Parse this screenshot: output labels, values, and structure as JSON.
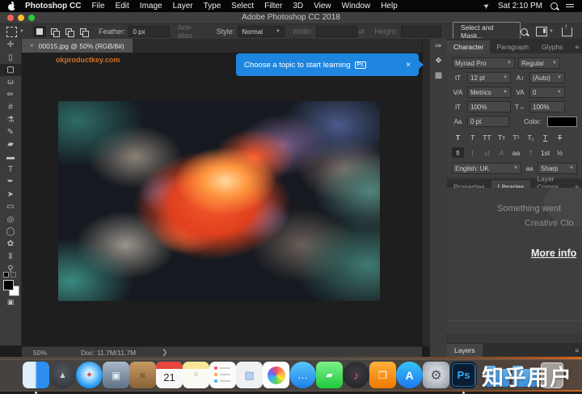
{
  "window": {
    "title": "Adobe Photoshop CC 2018"
  },
  "menu_bar": {
    "app_name": "Photoshop CC",
    "items": [
      "File",
      "Edit",
      "Image",
      "Layer",
      "Type",
      "Select",
      "Filter",
      "3D",
      "View",
      "Window",
      "Help"
    ],
    "clock": "Sat 2:10 PM"
  },
  "options_bar": {
    "feather_label": "Feather:",
    "feather_value": "0 px",
    "anti_alias_label": "Anti-alias",
    "style_label": "Style:",
    "style_value": "Normal",
    "width_label": "Width:",
    "height_label": "Height:",
    "select_and_mask_label": "Select and Mask...",
    "mode_buttons": [
      "new-selection",
      "add-to-selection",
      "subtract-from-selection",
      "intersect-with-selection"
    ]
  },
  "toolbar": {
    "tools": [
      {
        "name": "move-tool",
        "glyph": "✛"
      },
      {
        "name": "artboard-tool",
        "glyph": "▯"
      },
      {
        "name": "rectangular-marquee-tool",
        "glyph": "▢",
        "active": true
      },
      {
        "name": "lasso-tool",
        "glyph": "ω"
      },
      {
        "name": "quick-selection-tool",
        "glyph": "✏"
      },
      {
        "name": "crop-tool",
        "glyph": "#"
      },
      {
        "name": "eyedropper-tool",
        "glyph": "⚗"
      },
      {
        "name": "brush-tool",
        "glyph": "✎"
      },
      {
        "name": "eraser-tool",
        "glyph": "▰"
      },
      {
        "name": "gradient-tool",
        "glyph": "▬"
      },
      {
        "name": "type-tool",
        "glyph": "T"
      },
      {
        "name": "pen-tool",
        "glyph": "✒"
      },
      {
        "name": "path-selection-tool",
        "glyph": "➤"
      },
      {
        "name": "rectangle-tool",
        "glyph": "▭"
      },
      {
        "name": "ellipse-ring-tool",
        "glyph": "◎"
      },
      {
        "name": "ellipse-tool",
        "glyph": "◯"
      },
      {
        "name": "custom-shape-tool",
        "glyph": "✿"
      },
      {
        "name": "hand-tool",
        "glyph": "ʬ"
      },
      {
        "name": "zoom-tool",
        "glyph": "⚲"
      },
      {
        "name": "edit-toolbar",
        "glyph": "…"
      }
    ]
  },
  "document": {
    "tab_title": "00015.jpg @ 50% (RGB/8#)",
    "close": "×",
    "watermark": "okproductkey.com"
  },
  "notification": {
    "message": "Choose a topic to start learning",
    "badge": "Ps",
    "close": "×",
    "accent_color": "#1f86e0"
  },
  "right_panel": {
    "collapsed_icons": [
      {
        "name": "clone-source-panel-icon",
        "glyph": "✑"
      },
      {
        "name": "swatches-panel-icon",
        "glyph": "❖"
      },
      {
        "name": "character-styles-panel-icon",
        "glyph": "▦"
      }
    ],
    "character": {
      "tabs": [
        "Character",
        "Paragraph",
        "Glyphs"
      ],
      "font_family": "Myriad Pro",
      "font_style": "Regular",
      "size_icon": "tT",
      "size": "12 pt",
      "leading_icon": "A↕",
      "leading": "(Auto)",
      "kerning_icon": "V∕A",
      "kerning": "Metrics",
      "tracking_icon": "VA",
      "tracking": "0",
      "vscale_icon": "IT",
      "vscale": "100%",
      "hscale_icon": "T↔",
      "hscale": "100%",
      "baseline_icon": "Aa",
      "baseline": "0 pt",
      "color_label": "Color:",
      "color_value": "#000000",
      "style_buttons": [
        {
          "name": "faux-bold-button",
          "glyph": "T",
          "cls": "b"
        },
        {
          "name": "faux-italic-button",
          "glyph": "T",
          "cls": "i"
        },
        {
          "name": "all-caps-button",
          "glyph": "TT"
        },
        {
          "name": "small-caps-button",
          "glyph": "Tᴛ"
        },
        {
          "name": "superscript-button",
          "glyph": "T¹"
        },
        {
          "name": "subscript-button",
          "glyph": "T₁"
        },
        {
          "name": "underline-button",
          "glyph": "T",
          "cls": "u"
        },
        {
          "name": "strikethrough-button",
          "glyph": "T",
          "cls": "s"
        }
      ],
      "opentype_buttons": [
        {
          "name": "standard-ligatures-button",
          "glyph": "fi",
          "active": true
        },
        {
          "name": "contextual-alternates-button",
          "glyph": "ſ",
          "dis": true
        },
        {
          "name": "discretionary-ligatures-button",
          "glyph": "st",
          "dis": true
        },
        {
          "name": "swash-button",
          "glyph": "A",
          "cls": "i",
          "dis": true
        },
        {
          "name": "stylistic-alternates-button",
          "glyph": "aa"
        },
        {
          "name": "titling-alternates-button",
          "glyph": "T",
          "dis": true
        },
        {
          "name": "ordinals-button",
          "glyph": "1st"
        },
        {
          "name": "fractions-button",
          "glyph": "½"
        }
      ],
      "language": "English: UK",
      "antialias_icon": "aa",
      "antialias": "Sharp"
    },
    "panel_tabs": [
      "Properties",
      "Libraries",
      "Layer Comps"
    ],
    "libraries": {
      "line1": "Something went",
      "line2": "Creative Clo",
      "link": "More info"
    },
    "layers_tab": "Layers"
  },
  "status_bar": {
    "zoom": "50%",
    "doc_size": "Doc: 11.7M/11.7M",
    "chevron": "❯"
  },
  "dock": {
    "apps": [
      {
        "name": "finder",
        "shape": "sq",
        "bg": "linear-gradient(90deg,#dff0fb 0 47%,#2e8ef0 53%)",
        "glyph": "",
        "running": true
      },
      {
        "name": "launchpad",
        "shape": "ci",
        "bg": "radial-gradient(circle at 50% 40%,#53575f,#2b2e34)",
        "glyph": "▲",
        "gc": "#c9ced6",
        "gs": 11
      },
      {
        "name": "safari",
        "shape": "ci",
        "bg": "radial-gradient(circle at 50% 45%,#cdeeff 0 16%,#2a9df4 62%,#1470d8)",
        "glyph": "✦",
        "gc": "#e8453c",
        "gs": 11
      },
      {
        "name": "mail",
        "shape": "sq",
        "bg": "linear-gradient(180deg,#a8b8c8,#5e7186)",
        "glyph": "▣",
        "gc": "#e5edf4",
        "gs": 12
      },
      {
        "name": "contacts",
        "shape": "sq",
        "bg": "linear-gradient(180deg,#c89a62,#8a6336)",
        "glyph": "≡",
        "gc": "#5d4326",
        "gs": 12
      },
      {
        "name": "calendar",
        "shape": "sq",
        "bg": "#f8f8f8",
        "glyph": "21",
        "gc": "#2b2b2b",
        "gs": 13,
        "special": "calendar"
      },
      {
        "name": "notes",
        "shape": "sq",
        "bg": "linear-gradient(180deg,#f6e896 0 27%,#fbfbf6 27%)",
        "glyph": "≡",
        "gc": "#c9c4ae",
        "gs": 10
      },
      {
        "name": "reminders",
        "shape": "sq",
        "bg": "#fbfbfb",
        "glyph": "",
        "special": "reminders"
      },
      {
        "name": "preview",
        "shape": "sq",
        "bg": "#eef0f2",
        "glyph": "▧",
        "gc": "#6aa1d8",
        "gs": 13
      },
      {
        "name": "photos",
        "shape": "sq",
        "bg": "#ffffff",
        "glyph": "",
        "special": "photos"
      },
      {
        "name": "messages",
        "shape": "ci",
        "bg": "linear-gradient(180deg,#59c7fb,#1d7fe8)",
        "glyph": "…",
        "gc": "#ffffff",
        "gs": 13
      },
      {
        "name": "facetime",
        "shape": "sq",
        "bg": "linear-gradient(180deg,#7ef08b,#1fc93c)",
        "glyph": "▰",
        "gc": "#ffffff",
        "gs": 11
      },
      {
        "name": "itunes",
        "shape": "ci",
        "bg": "radial-gradient(circle at 50% 40%,#3c3c42,#1f1f24)",
        "glyph": "♪",
        "gc": "#f2568c",
        "gs": 14
      },
      {
        "name": "ibooks",
        "shape": "sq",
        "bg": "linear-gradient(180deg,#ffb13d,#f07800)",
        "glyph": "❐",
        "gc": "#ffffff",
        "gs": 12
      },
      {
        "name": "app-store",
        "shape": "ci",
        "bg": "linear-gradient(180deg,#37c3f8,#1c78ee)",
        "glyph": "A",
        "gc": "#ffffff",
        "gs": 14,
        "bold": true
      },
      {
        "name": "system-preferences",
        "shape": "sq",
        "bg": "radial-gradient(circle at 50% 45%,#cfd3d8 0 30%,#8d949c)",
        "glyph": "⚙",
        "gc": "#4d5259",
        "gs": 16
      },
      {
        "name": "photoshop",
        "shape": "sq",
        "bg": "#0b1d30",
        "glyph": "Ps",
        "gc": "#31a8ff",
        "gs": 13,
        "bold": true,
        "running": true,
        "special": "ps"
      },
      {
        "name": "folder-1",
        "shape": "none",
        "special": "folder"
      },
      {
        "name": "folder-2",
        "shape": "none",
        "special": "folder"
      },
      {
        "name": "trash",
        "shape": "none",
        "special": "trash"
      }
    ]
  },
  "overlay_watermark": "知乎用户"
}
